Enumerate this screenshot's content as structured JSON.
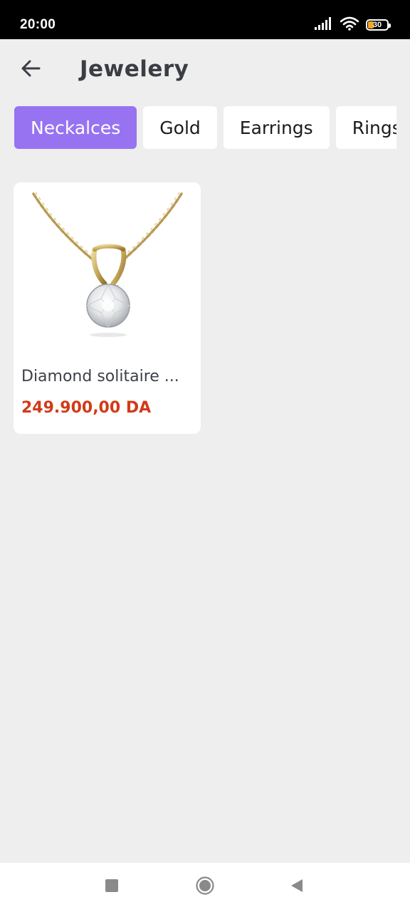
{
  "status_bar": {
    "time": "20:00",
    "battery_level": "30",
    "icons": [
      "signal-icon",
      "wifi-icon",
      "battery-icon"
    ]
  },
  "header": {
    "title": "Jewelery",
    "back_icon": "arrow-left-icon"
  },
  "categories": [
    {
      "label": "Neckalces",
      "active": true
    },
    {
      "label": "Gold",
      "active": false
    },
    {
      "label": "Earrings",
      "active": false
    },
    {
      "label": "Rings",
      "active": false
    }
  ],
  "products": [
    {
      "name": "Diamond solitaire ...",
      "price": "249.900,00 DA",
      "image": "diamond-pendant-necklace"
    }
  ],
  "nav_bar": {
    "icons": [
      "recents-icon",
      "home-icon",
      "back-icon"
    ]
  },
  "colors": {
    "accent": "#9773f2",
    "price": "#d13b18",
    "background": "#eeeeee",
    "title": "#3a3d44"
  }
}
